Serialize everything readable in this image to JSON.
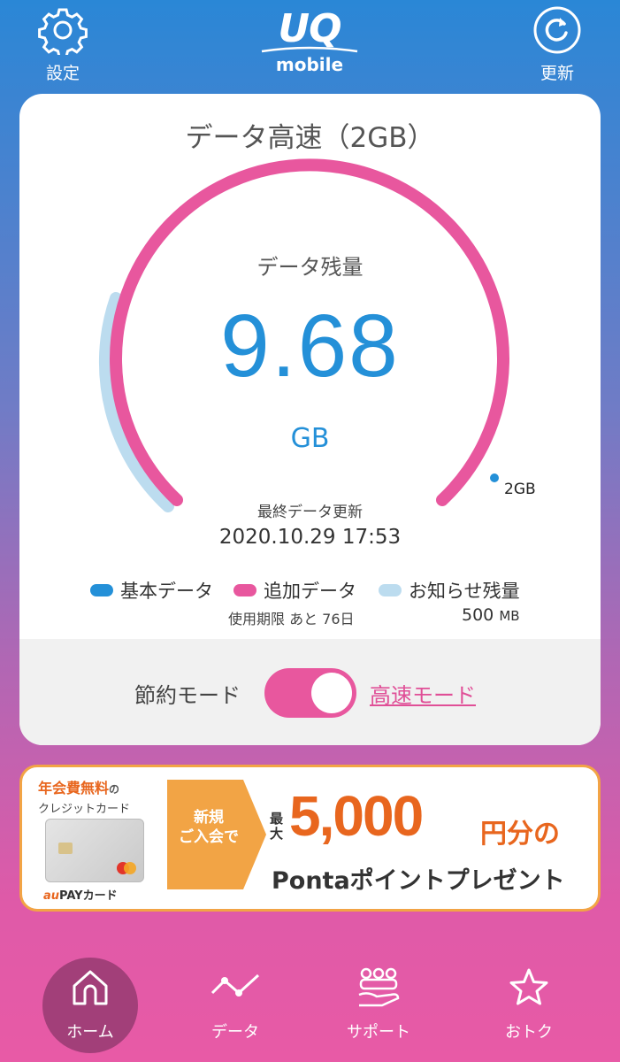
{
  "header": {
    "settings_label": "設定",
    "refresh_label": "更新",
    "logo_main": "UQ",
    "logo_sub": "mobile"
  },
  "card": {
    "title": "データ高速（2GB）",
    "remaining_label": "データ残量",
    "remaining_value": "9.68",
    "remaining_unit": "GB",
    "gauge_marker_label": "2GB",
    "updated_label": "最終データ更新",
    "updated_value": "2020.10.29 17:53",
    "legend": {
      "basic": "基本データ",
      "added": "追加データ",
      "notice": "お知らせ残量",
      "added_sub": "使用期限 あと 76日",
      "notice_value": "500",
      "notice_unit": "MB"
    },
    "mode": {
      "saving_label": "節約モード",
      "toggle_on": true,
      "fast_label": "高速モード"
    }
  },
  "banner": {
    "line1": "年会費無料",
    "line1_suffix": "の",
    "line2": "クレジットカード",
    "card_brand_au": "au",
    "card_brand_rest": "PAYカード",
    "arrow_text_1": "新規",
    "arrow_text_2": "ご入会で",
    "max_label": "最大",
    "amount": "5,000",
    "amount_unit": "円分の",
    "sub": "Pontaポイントプレゼント"
  },
  "nav": {
    "home": "ホーム",
    "data": "データ",
    "support": "サポート",
    "deals": "おトク"
  },
  "colors": {
    "basic": "#2490d8",
    "added": "#e8579e",
    "notice": "#bcdcef",
    "accent_orange": "#e8661e"
  }
}
